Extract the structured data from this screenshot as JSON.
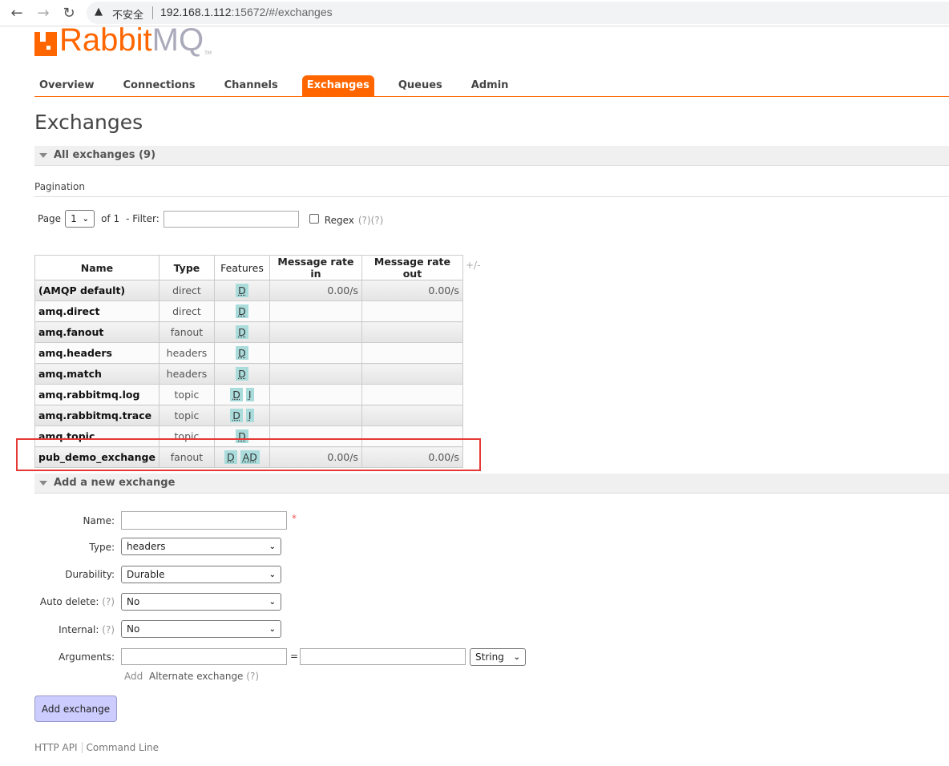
{
  "browser": {
    "security_icon": "warning-triangle-icon",
    "security_label": "不安全",
    "url_host": "192.168.1.112",
    "url_rest": ":15672/#/exchanges"
  },
  "logo": {
    "text_main": "Rabbit",
    "text_accent": "MQ",
    "tm": "TM"
  },
  "colors": {
    "brand": "#ff6600",
    "badge": "#aadcdc",
    "highlight_box": "#e53935",
    "button": "#ccccff"
  },
  "nav": {
    "tabs": [
      "Overview",
      "Connections",
      "Channels",
      "Exchanges",
      "Queues",
      "Admin"
    ],
    "active": "Exchanges"
  },
  "page": {
    "title": "Exchanges"
  },
  "all_section": {
    "title": "All exchanges (9)"
  },
  "pagination": {
    "label": "Pagination",
    "page_label": "Page",
    "page_value": "1",
    "of_label": "of 1",
    "filter_label": "- Filter:",
    "filter_value": "",
    "regex_label": "Regex",
    "help1": "(?)",
    "help2": "(?)"
  },
  "table": {
    "columns": [
      "Name",
      "Type",
      "Features",
      "Message rate in",
      "Message rate out"
    ],
    "toggle": "+/-",
    "rows": [
      {
        "name": "(AMQP default)",
        "type": "direct",
        "features": [
          "D"
        ],
        "rate_in": "0.00/s",
        "rate_out": "0.00/s"
      },
      {
        "name": "amq.direct",
        "type": "direct",
        "features": [
          "D"
        ],
        "rate_in": "",
        "rate_out": ""
      },
      {
        "name": "amq.fanout",
        "type": "fanout",
        "features": [
          "D"
        ],
        "rate_in": "",
        "rate_out": ""
      },
      {
        "name": "amq.headers",
        "type": "headers",
        "features": [
          "D"
        ],
        "rate_in": "",
        "rate_out": ""
      },
      {
        "name": "amq.match",
        "type": "headers",
        "features": [
          "D"
        ],
        "rate_in": "",
        "rate_out": ""
      },
      {
        "name": "amq.rabbitmq.log",
        "type": "topic",
        "features": [
          "D",
          "I"
        ],
        "rate_in": "",
        "rate_out": ""
      },
      {
        "name": "amq.rabbitmq.trace",
        "type": "topic",
        "features": [
          "D",
          "I"
        ],
        "rate_in": "",
        "rate_out": ""
      },
      {
        "name": "amq.topic",
        "type": "topic",
        "features": [
          "D"
        ],
        "rate_in": "",
        "rate_out": ""
      },
      {
        "name": "pub_demo_exchange",
        "type": "fanout",
        "features": [
          "D",
          "AD"
        ],
        "rate_in": "0.00/s",
        "rate_out": "0.00/s"
      }
    ]
  },
  "add_section": {
    "title": "Add a new exchange",
    "name_label": "Name:",
    "name_value": "",
    "required": "*",
    "type_label": "Type:",
    "type_value": "headers",
    "durability_label": "Durability:",
    "durability_value": "Durable",
    "auto_delete_label": "Auto delete:",
    "auto_delete_value": "No",
    "internal_label": "Internal:",
    "internal_value": "No",
    "help": "(?)",
    "arguments_label": "Arguments:",
    "arg_key": "",
    "equals": "=",
    "arg_value": "",
    "arg_type": "String",
    "add_link": "Add",
    "alt_exchange": "Alternate exchange",
    "submit": "Add exchange"
  },
  "footer": {
    "links": [
      "HTTP API",
      "Command Line"
    ]
  }
}
